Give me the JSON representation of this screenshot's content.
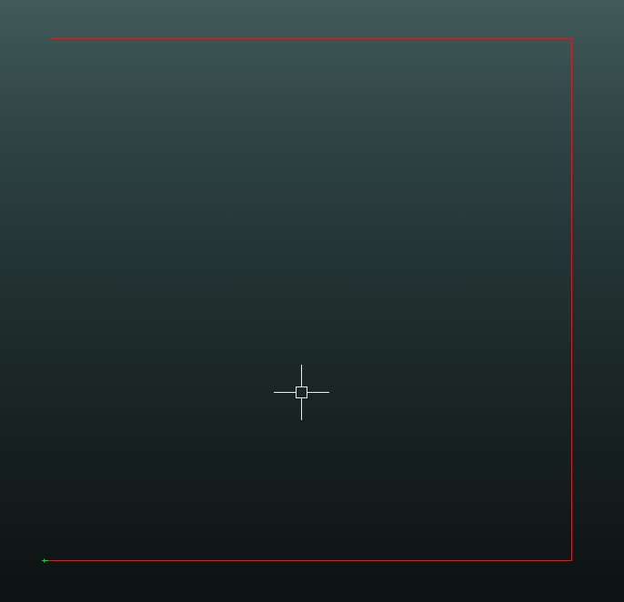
{
  "viewport": {
    "background_top": "#425a5a",
    "background_bottom": "#0d1212"
  },
  "drawing": {
    "limits_color": "#c62828"
  },
  "ucs": {
    "origin_marker_color": "#2fbf3a"
  },
  "cursor": {
    "crosshair_color": "#e9ecec",
    "pickbox_color": "#e9ecec"
  }
}
